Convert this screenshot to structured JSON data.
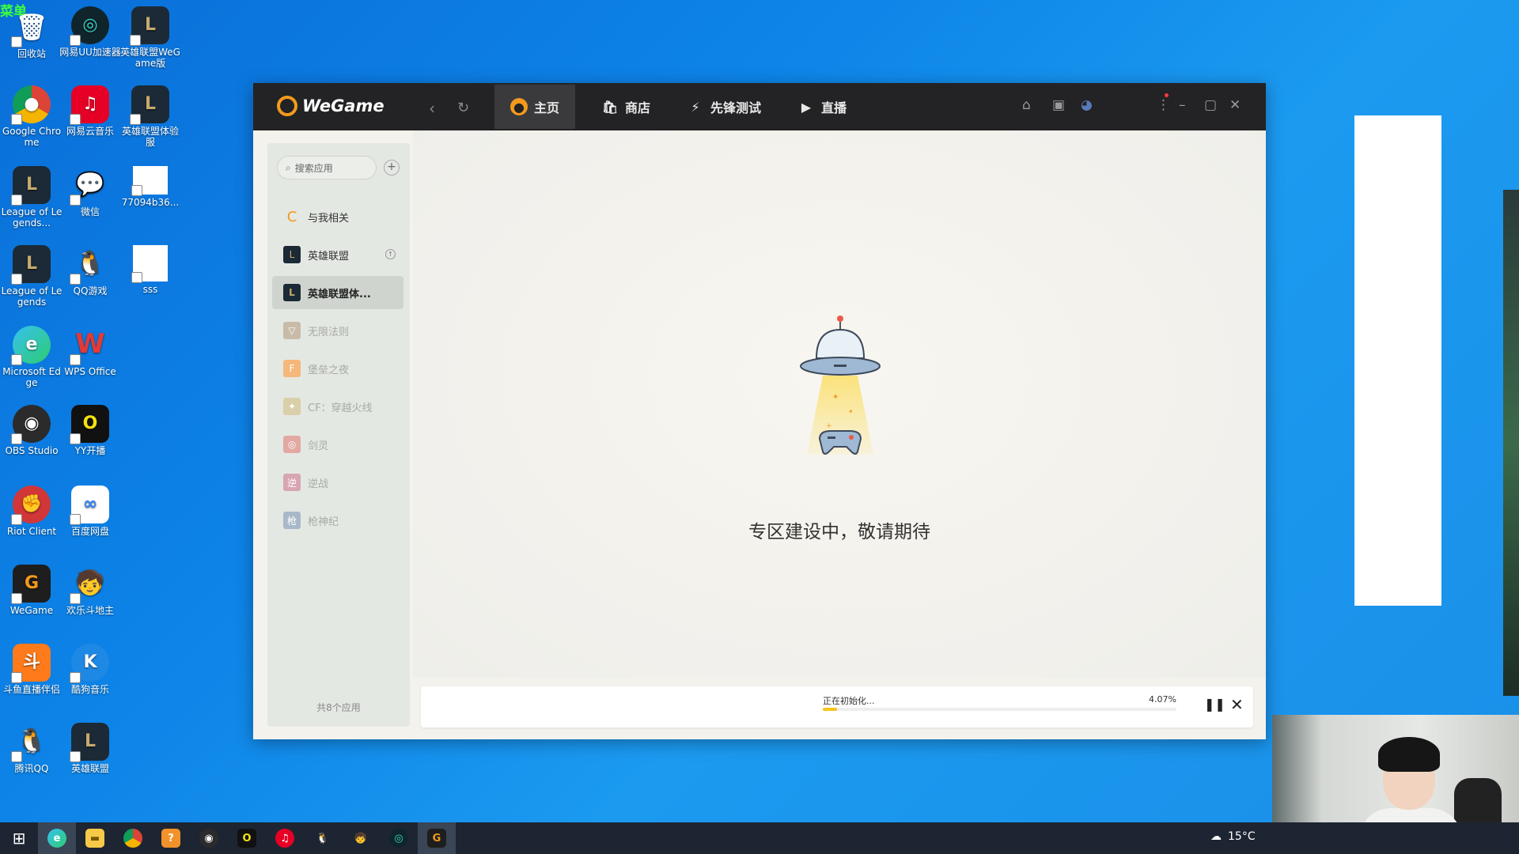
{
  "corner_label": "菜单",
  "desktop_icons": [
    {
      "label": "回收站"
    },
    {
      "label": "网易UU加速器"
    },
    {
      "label": "英雄联盟WeGame版"
    },
    {
      "label": "Google Chrome"
    },
    {
      "label": "网易云音乐"
    },
    {
      "label": "英雄联盟体验服"
    },
    {
      "label": "League of Legends..."
    },
    {
      "label": "微信"
    },
    {
      "label": "77094b36..."
    },
    {
      "label": "League of Legends"
    },
    {
      "label": "QQ游戏"
    },
    {
      "label": "sss"
    },
    {
      "label": "Microsoft Edge"
    },
    {
      "label": "WPS Office"
    },
    {
      "label": "OBS Studio"
    },
    {
      "label": "YY开播"
    },
    {
      "label": "Riot Client"
    },
    {
      "label": "百度网盘"
    },
    {
      "label": "WeGame"
    },
    {
      "label": "欢乐斗地主"
    },
    {
      "label": "斗鱼直播伴侣"
    },
    {
      "label": "酷狗音乐"
    },
    {
      "label": "腾讯QQ"
    },
    {
      "label": "英雄联盟"
    }
  ],
  "wegame": {
    "logo_text": "WeGame",
    "tabs": [
      {
        "label": "主页"
      },
      {
        "label": "商店"
      },
      {
        "label": "先锋测试"
      },
      {
        "label": "直播"
      }
    ],
    "sidebar": {
      "search_placeholder": "搜索应用",
      "items": [
        {
          "label": "与我相关"
        },
        {
          "label": "英雄联盟"
        },
        {
          "label": "英雄联盟体..."
        },
        {
          "label": "无限法则"
        },
        {
          "label": "堡垒之夜"
        },
        {
          "label": "CF：穿越火线"
        },
        {
          "label": "剑灵"
        },
        {
          "label": "逆战"
        },
        {
          "label": "枪神纪"
        }
      ],
      "footer": "共8个应用"
    },
    "main": {
      "message": "专区建设中，敬请期待"
    },
    "download": {
      "status": "正在初始化...",
      "percent_label": "4.07%",
      "progress": 0.0407
    }
  },
  "taskbar": {
    "weather": "15°C"
  },
  "colors": {
    "accent": "#f39a1d",
    "progress": "#f5c518",
    "titlebar": "#232325"
  }
}
